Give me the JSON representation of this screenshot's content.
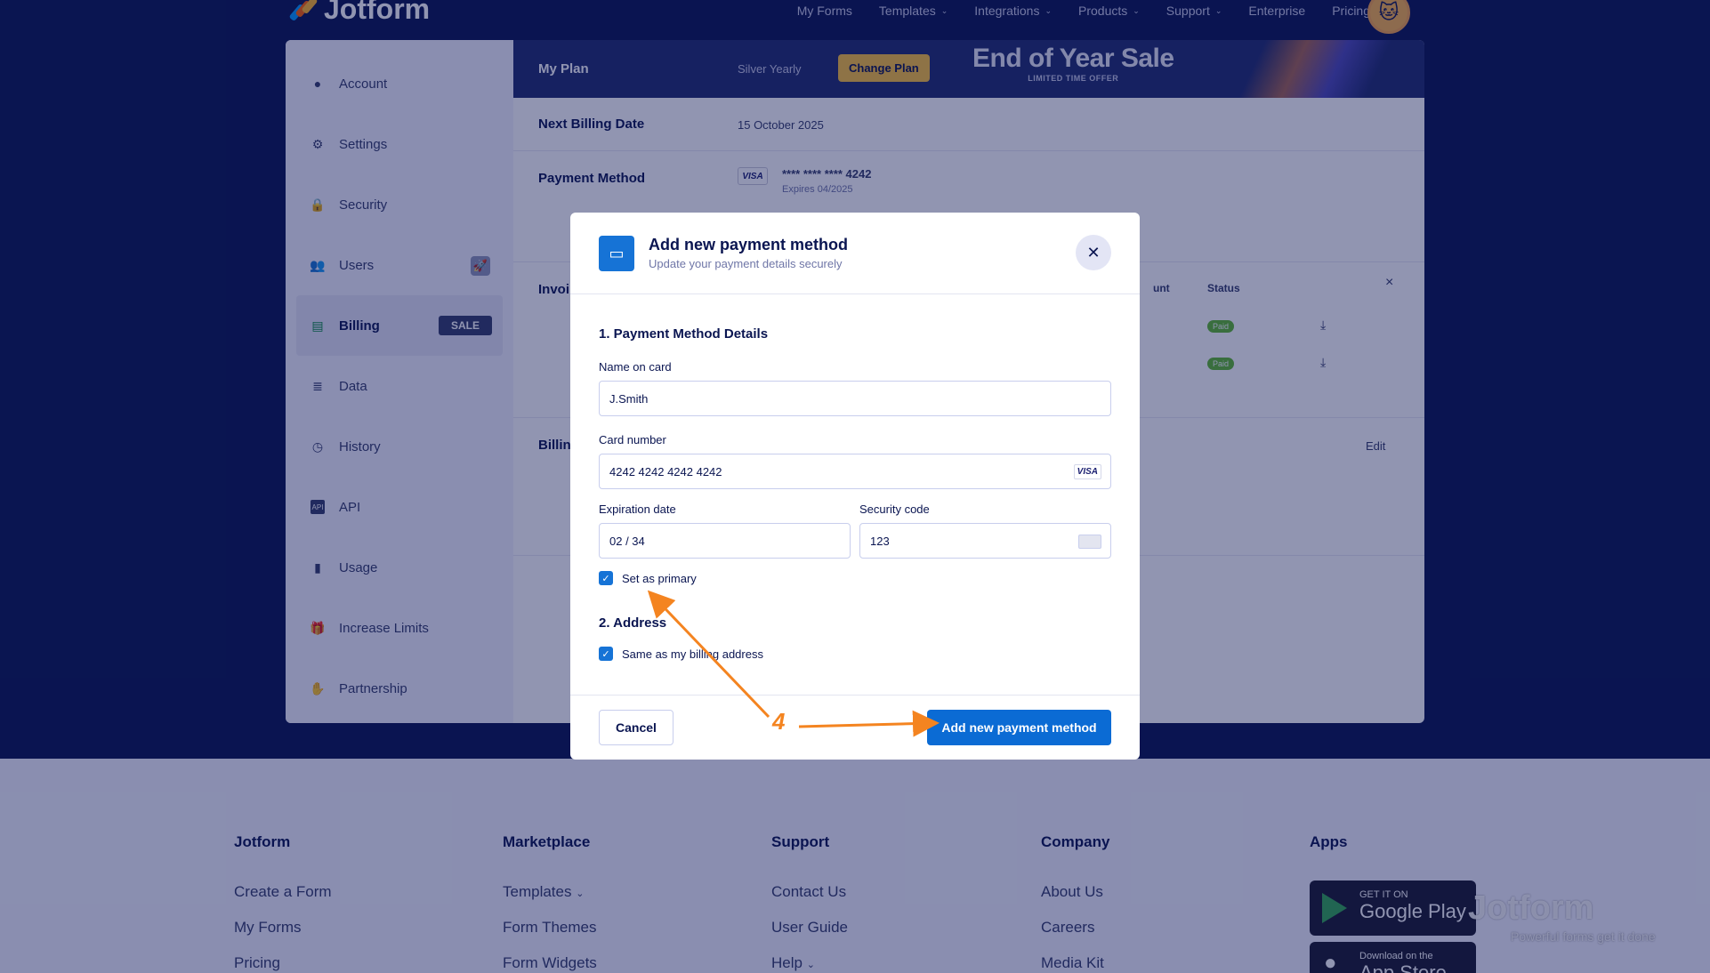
{
  "brand": {
    "name": "Jotform",
    "colors": {
      "navy": "#0a1551",
      "blue": "#0b6bd4",
      "orange": "#f48420",
      "yellow": "#f9c23c"
    }
  },
  "nav": {
    "items": [
      "My Forms",
      "Templates",
      "Integrations",
      "Products",
      "Support",
      "Enterprise",
      "Pricing"
    ]
  },
  "sidebar": {
    "items": [
      {
        "label": "Account",
        "icon": "user-icon"
      },
      {
        "label": "Settings",
        "icon": "gear-icon"
      },
      {
        "label": "Security",
        "icon": "lock-icon"
      },
      {
        "label": "Users",
        "icon": "users-icon"
      },
      {
        "label": "Billing",
        "icon": "billing-icon",
        "badge": "SALE"
      },
      {
        "label": "Data",
        "icon": "database-icon"
      },
      {
        "label": "History",
        "icon": "history-icon"
      },
      {
        "label": "API",
        "icon": "api-icon"
      },
      {
        "label": "Usage",
        "icon": "bar-chart-icon"
      },
      {
        "label": "Increase Limits",
        "icon": "gift-icon"
      },
      {
        "label": "Partnership",
        "icon": "handshake-icon"
      }
    ]
  },
  "plan": {
    "title": "My Plan",
    "value": "Silver Yearly",
    "change_label": "Change Plan",
    "banner_big": "End of Year Sale",
    "banner_small": "LIMITED TIME OFFER"
  },
  "billing": {
    "next_label": "Next Billing Date",
    "next_value": "15 October 2025",
    "payment_label": "Payment Method",
    "card_brand": "VISA",
    "card_masked": "**** **** **** 4242",
    "card_expires": "Expires 04/2025",
    "invoices_label": "Invoi",
    "billing_label": "Billin",
    "edit_label": "Edit",
    "table_headers": [
      "unt",
      "Status"
    ],
    "statuses": [
      "Paid",
      "Paid"
    ]
  },
  "modal": {
    "title": "Add new payment method",
    "subtitle": "Update your payment details securely",
    "section1": "1. Payment Method Details",
    "name_label": "Name on card",
    "name_value": "J.Smith",
    "card_label": "Card number",
    "card_value": "4242 4242 4242 4242",
    "card_brand": "VISA",
    "exp_label": "Expiration date",
    "exp_value": "02 / 34",
    "cvc_label": "Security code",
    "cvc_value": "123",
    "primary_label": "Set as primary",
    "section2": "2. Address",
    "same_address_label": "Same as my billing address",
    "cancel_label": "Cancel",
    "submit_label": "Add new payment method"
  },
  "annotation": {
    "step": "4"
  },
  "footer": {
    "columns": [
      {
        "title": "Jotform",
        "links": [
          "Create a Form",
          "My Forms",
          "Pricing"
        ]
      },
      {
        "title": "Marketplace",
        "links": [
          "Templates",
          "Form Themes",
          "Form Widgets"
        ]
      },
      {
        "title": "Support",
        "links": [
          "Contact Us",
          "User Guide",
          "Help"
        ]
      },
      {
        "title": "Company",
        "links": [
          "About Us",
          "Careers",
          "Media Kit"
        ]
      },
      {
        "title": "Apps",
        "links": []
      }
    ],
    "google_small": "GET IT ON",
    "google_big": "Google Play",
    "apple_small": "Download on the",
    "apple_big": "App Store",
    "watermark": "Jotform",
    "watermark_tag": "Powerful forms get it done"
  }
}
